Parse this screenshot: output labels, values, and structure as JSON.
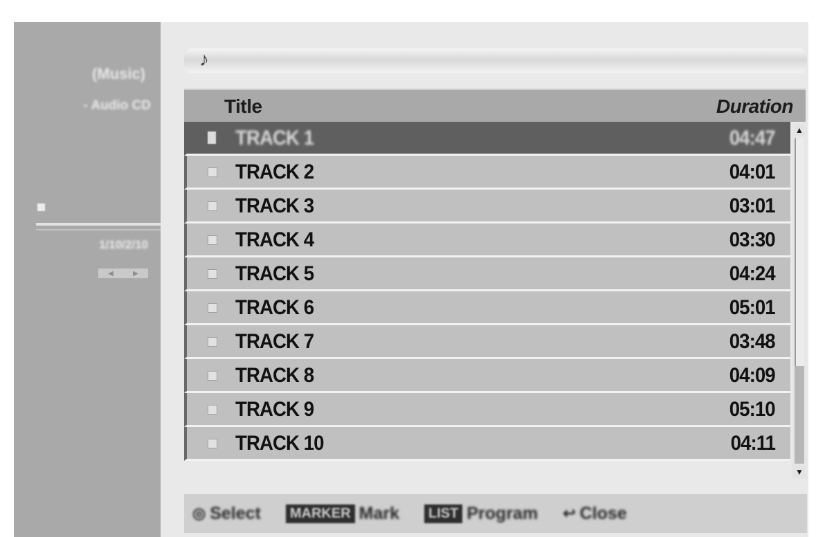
{
  "sidebar": {
    "title": "(Music)",
    "subtitle": "- Audio CD",
    "counter": "1/10/2/10"
  },
  "path": {
    "icon": "music-note-icon"
  },
  "table": {
    "col_title": "Title",
    "col_duration": "Duration",
    "rows": [
      {
        "title": "TRACK 1",
        "duration": "04:47",
        "selected": true
      },
      {
        "title": "TRACK 2",
        "duration": "04:01"
      },
      {
        "title": "TRACK 3",
        "duration": "03:01"
      },
      {
        "title": "TRACK 4",
        "duration": "03:30"
      },
      {
        "title": "TRACK 5",
        "duration": "04:24"
      },
      {
        "title": "TRACK 6",
        "duration": "05:01"
      },
      {
        "title": "TRACK 7",
        "duration": "03:48"
      },
      {
        "title": "TRACK 8",
        "duration": "04:09"
      },
      {
        "title": "TRACK 9",
        "duration": "05:10"
      },
      {
        "title": "TRACK 10",
        "duration": "04:11"
      }
    ]
  },
  "scroll": {
    "position": 0.0,
    "visible_fraction": 0.7
  },
  "footer": {
    "select_label": "Select",
    "mark_key": "MARKER",
    "mark_label": "Mark",
    "list_key": "LIST",
    "list_label": "Program",
    "close_label": "Close"
  },
  "colors": {
    "sidebar_bg": "#a9a9a9",
    "row_bg": "#c0c0c0",
    "selected_row_bg": "#5f5f5f"
  }
}
